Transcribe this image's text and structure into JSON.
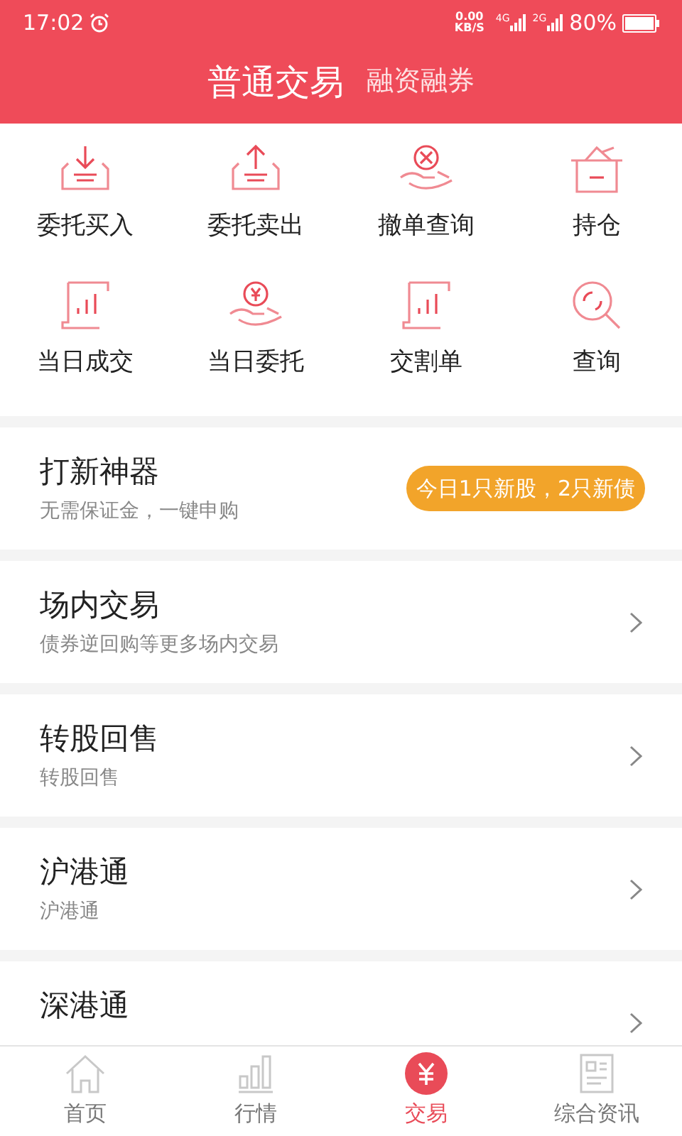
{
  "status_bar": {
    "time": "17:02",
    "net_speed": "0.00",
    "net_unit": "KB/S",
    "sim1": "4G",
    "sim2": "2G",
    "battery": "80%"
  },
  "header_tabs": [
    {
      "label": "普通交易",
      "selected": true
    },
    {
      "label": "融资融券",
      "selected": false
    }
  ],
  "actions": [
    {
      "label": "委托买入"
    },
    {
      "label": "委托卖出"
    },
    {
      "label": "撤单查询"
    },
    {
      "label": "持仓"
    },
    {
      "label": "当日成交"
    },
    {
      "label": "当日委托"
    },
    {
      "label": "交割单"
    },
    {
      "label": "查询"
    }
  ],
  "sections": [
    {
      "kind": "promo",
      "title": "打新神器",
      "subtitle": "无需保证金，一键申购",
      "badge": "今日1只新股，2只新债"
    },
    {
      "kind": "link",
      "title": "场内交易",
      "subtitle": "债券逆回购等更多场内交易"
    },
    {
      "kind": "link",
      "title": "转股回售",
      "subtitle": "转股回售"
    },
    {
      "kind": "link",
      "title": "沪港通",
      "subtitle": "沪港通"
    },
    {
      "kind": "link",
      "title": "深港通"
    }
  ],
  "bottom_nav": [
    {
      "label": "首页",
      "selected": false
    },
    {
      "label": "行情",
      "selected": false
    },
    {
      "label": "交易",
      "selected": true
    },
    {
      "label": "综合资讯",
      "selected": false
    }
  ]
}
